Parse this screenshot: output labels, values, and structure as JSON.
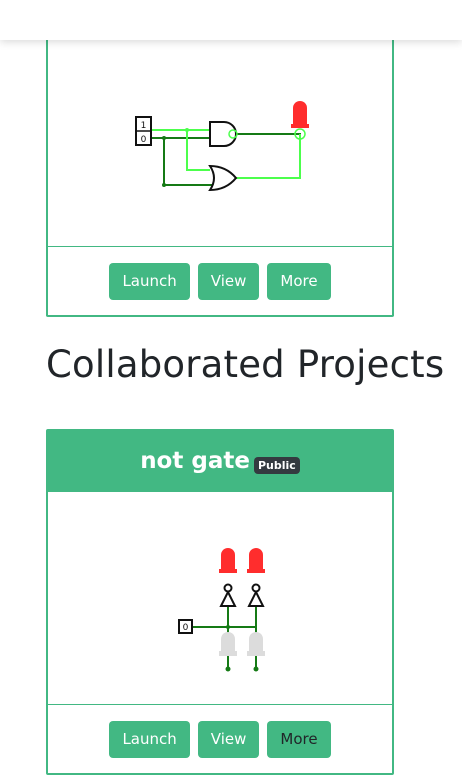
{
  "owned_project": {
    "buttons": {
      "launch": "Launch",
      "view": "View",
      "more": "More"
    },
    "circuit_labels": {
      "input_top": "1",
      "input_bottom": "0"
    }
  },
  "collaborated": {
    "heading": "Collaborated Projects",
    "project": {
      "title": "not gate",
      "badge": "Public",
      "circuit_labels": {
        "input": "0"
      },
      "buttons": {
        "launch": "Launch",
        "view": "View",
        "more": "More"
      }
    }
  },
  "colors": {
    "accent": "#42b883",
    "wire_on": "#4cff4c",
    "wire_off": "#157a15",
    "led_on": "#ff2d2d",
    "led_off": "#d8d8d8",
    "badge": "#343a40"
  }
}
